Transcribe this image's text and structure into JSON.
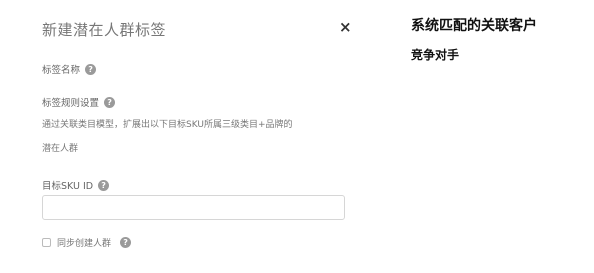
{
  "dialog": {
    "title": "新建潜在人群标签",
    "close_symbol": "×",
    "tag_name_label": "标签名称",
    "rule_settings_label": "标签规则设置",
    "description_line1": "通过关联类目模型，扩展出以下目标SKU所属三级类目+品牌的",
    "description_line2": "潜在人群",
    "sku_label": "目标SKU ID",
    "sku_input": {
      "value": "",
      "placeholder": ""
    },
    "sync_label": "同步创建人群",
    "help_glyph": "?"
  },
  "side_text": {
    "line1": "系统匹配的关联客户",
    "overlap": "竞争对手"
  }
}
